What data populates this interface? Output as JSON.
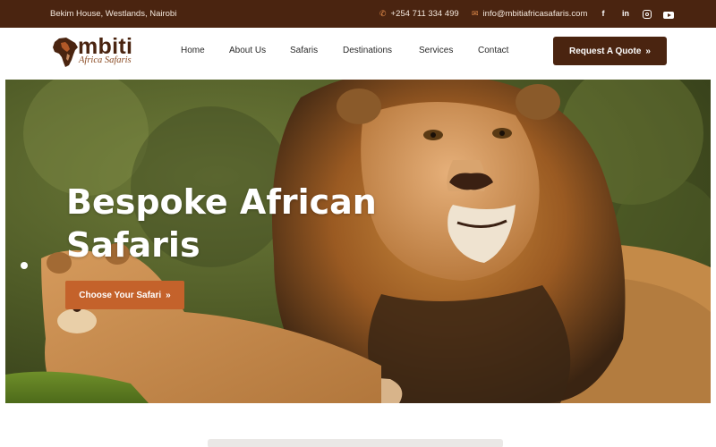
{
  "topbar": {
    "address": "Bekim House, Westlands, Nairobi",
    "phone": "+254 711 334 499",
    "email": "info@mbitiafricasafaris.com",
    "icons": {
      "phone": "phone-icon",
      "email": "mail-icon"
    },
    "socials": [
      {
        "name": "facebook-icon",
        "glyph": "f"
      },
      {
        "name": "linkedin-icon",
        "glyph": "in"
      },
      {
        "name": "instagram-icon",
        "glyph": ""
      },
      {
        "name": "youtube-icon",
        "glyph": ""
      }
    ]
  },
  "logo": {
    "brand": "mbiti",
    "tagline": "Africa Safaris"
  },
  "nav": {
    "items": [
      "Home",
      "About Us",
      "Safaris",
      "Destinations",
      "Services",
      "Contact"
    ],
    "cta_label": "Request A Quote",
    "cta_icon": "»"
  },
  "hero": {
    "title_line1": "Bespoke African",
    "title_line2": "Safaris",
    "cta_label": "Choose Your Safari",
    "cta_icon": "»"
  },
  "colors": {
    "brand_brown": "#4a2410",
    "accent_orange": "#c4622b",
    "white": "#ffffff"
  }
}
